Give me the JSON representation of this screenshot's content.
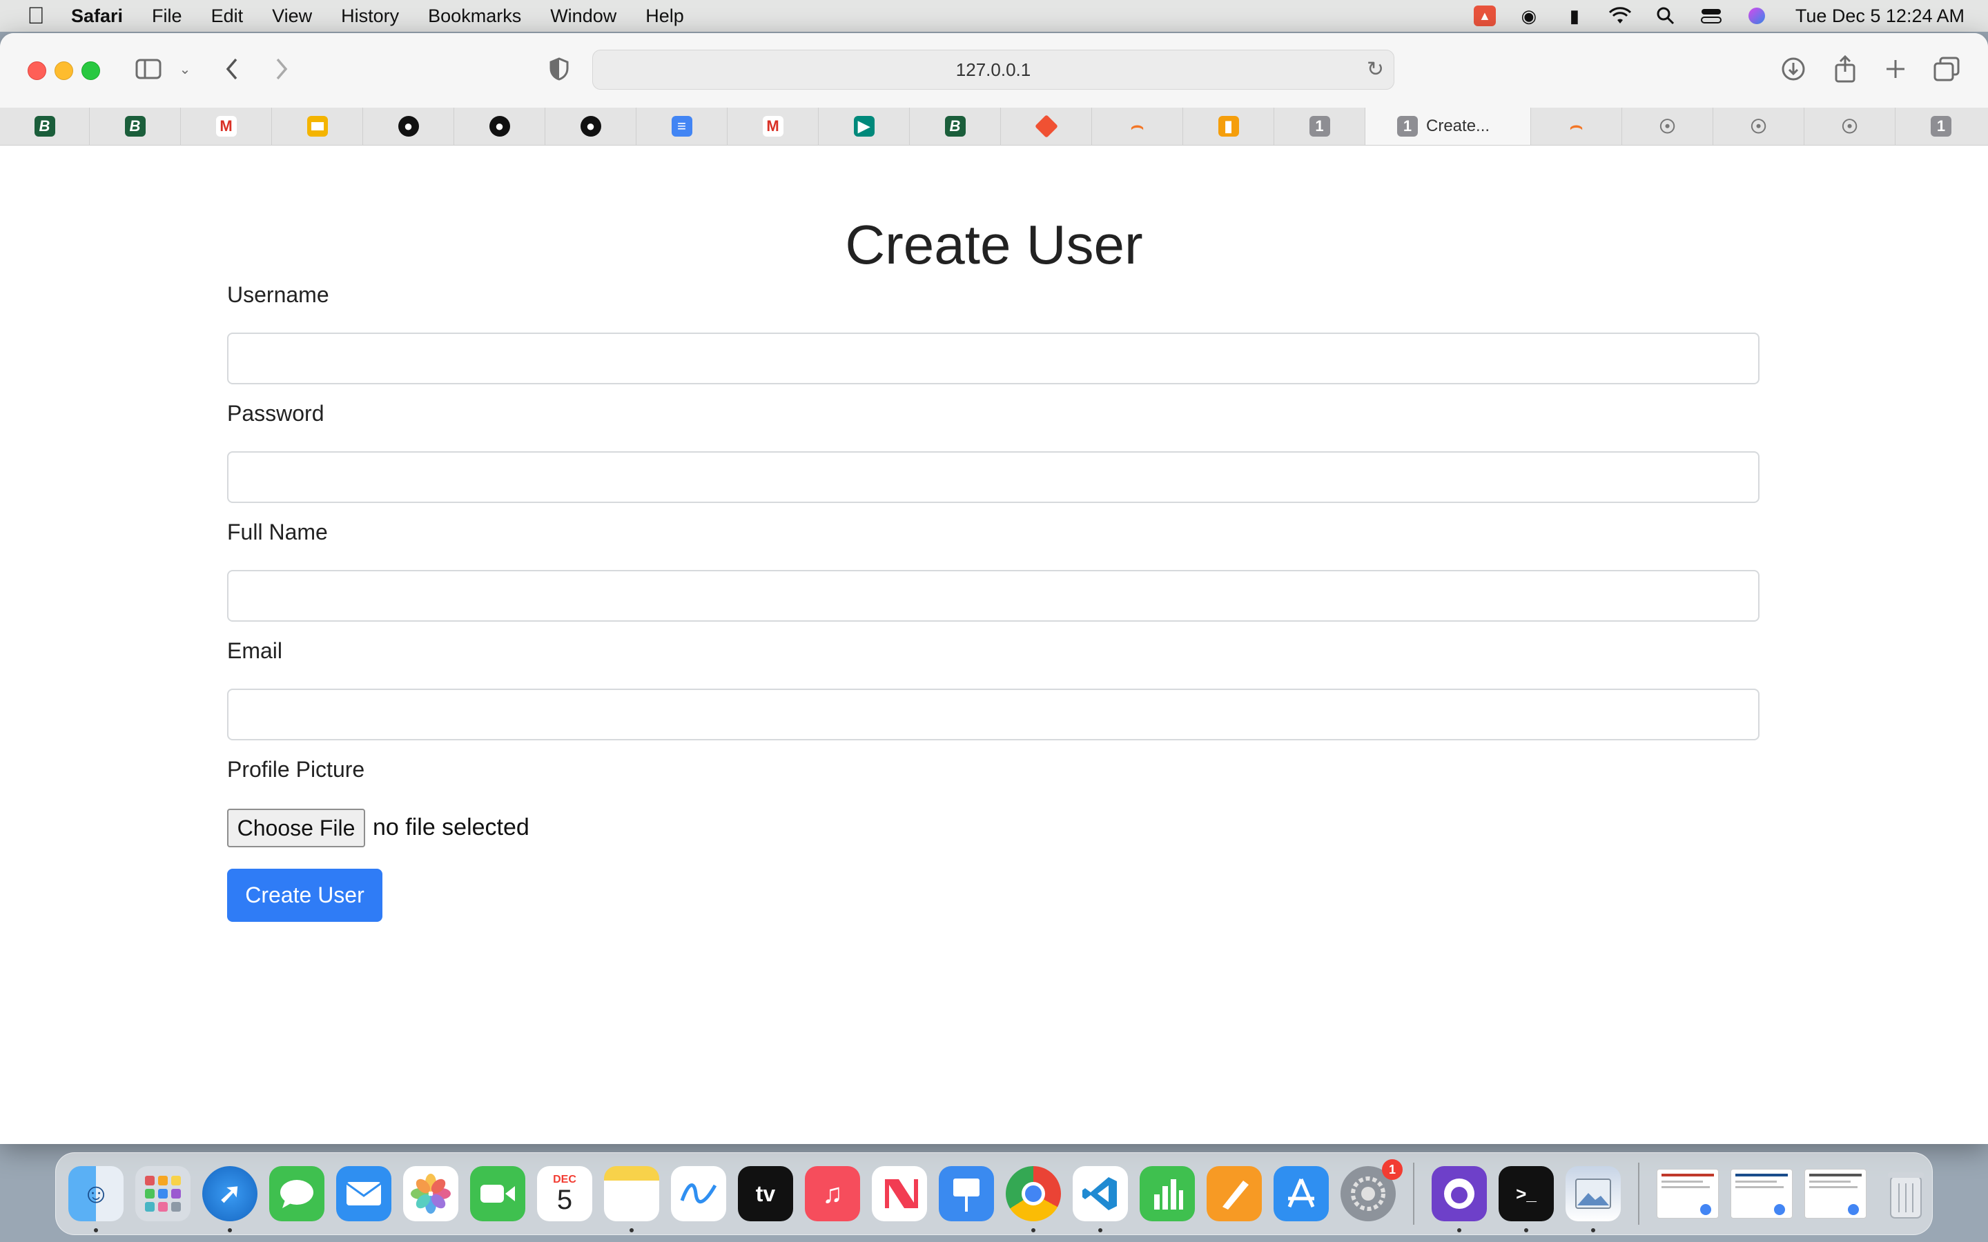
{
  "menubar": {
    "app_name": "Safari",
    "menus": [
      "File",
      "Edit",
      "View",
      "History",
      "Bookmarks",
      "Window",
      "Help"
    ],
    "clock": "Tue Dec 5  12:24 AM"
  },
  "browser": {
    "url": "127.0.0.1",
    "active_tab_title": "Create...",
    "active_tab_badge": "1",
    "numbered_tab_badge": "1"
  },
  "form": {
    "title": "Create User",
    "username_label": "Username",
    "password_label": "Password",
    "fullname_label": "Full Name",
    "email_label": "Email",
    "picture_label": "Profile Picture",
    "choose_file_label": "Choose File",
    "file_status": "no file selected",
    "submit_label": "Create User"
  },
  "dock": {
    "calendar_month": "DEC",
    "calendar_day": "5",
    "settings_badge": "1",
    "tv_label": "tv"
  }
}
